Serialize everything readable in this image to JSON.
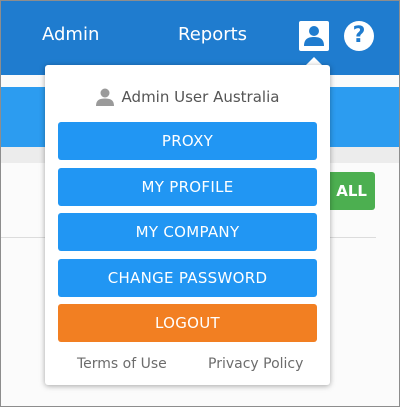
{
  "nav": {
    "admin_label": "Admin",
    "reports_label": "Reports",
    "user_icon": "user-icon",
    "help_icon": "help-icon",
    "help_glyph": "?"
  },
  "page": {
    "green_button_label": "ALL"
  },
  "dropdown": {
    "user_name": "Admin User Australia",
    "items": [
      {
        "label": "PROXY"
      },
      {
        "label": "MY PROFILE"
      },
      {
        "label": "MY COMPANY"
      },
      {
        "label": "CHANGE PASSWORD"
      },
      {
        "label": "LOGOUT"
      }
    ],
    "footer": {
      "terms": "Terms of Use",
      "privacy": "Privacy Policy"
    }
  },
  "colors": {
    "header": "#1f7ccf",
    "subbar": "#2c9cf0",
    "menu_button": "#2196f3",
    "logout_button": "#f27f22",
    "green_button": "#4caf50"
  }
}
